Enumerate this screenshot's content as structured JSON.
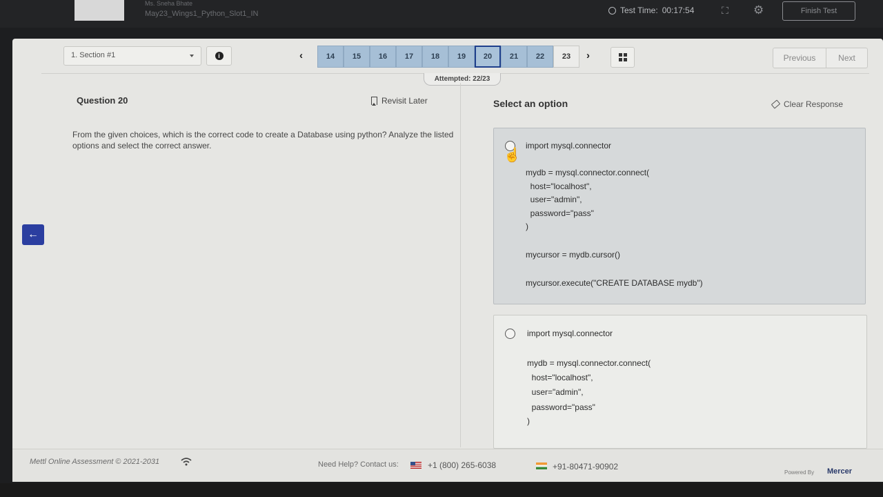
{
  "header": {
    "candidate_name": "Ms. Sneha Bhate",
    "test_name": "May23_Wings1_Python_Slot1_IN",
    "timer_label": "Test Time:",
    "timer_value": "00:17:54",
    "finish_label": "Finish Test"
  },
  "nav": {
    "section": "1. Section #1",
    "info_glyph": "i",
    "question_numbers": [
      "14",
      "15",
      "16",
      "17",
      "18",
      "19",
      "20",
      "21",
      "22",
      "23"
    ],
    "current_question": "20",
    "attempted": "Attempted: 22/23",
    "previous_label": "Previous",
    "next_label": "Next"
  },
  "question": {
    "title": "Question 20",
    "revisit_label": "Revisit Later",
    "text": "From the given choices, which is the correct code to create a Database using python? Analyze the listed options and select the correct answer."
  },
  "answer": {
    "heading": "Select an option",
    "clear_label": "Clear Response",
    "options": [
      {
        "lines": [
          "import mysql.connector",
          "",
          "mydb = mysql.connector.connect(",
          "  host=\"localhost\",",
          "  user=\"admin\",",
          "  password=\"pass\"",
          ")",
          "",
          "mycursor = mydb.cursor()",
          "",
          "mycursor.execute(\"CREATE DATABASE mydb\")"
        ]
      },
      {
        "lines": [
          "import mysql.connector",
          "",
          "mydb = mysql.connector.connect(",
          "  host=\"localhost\",",
          "  user=\"admin\",",
          "  password=\"pass\"",
          ")"
        ]
      }
    ]
  },
  "footer": {
    "copyright": "Mettl Online Assessment © 2021-2031",
    "help_label": "Need Help? Contact us:",
    "phone_us": "+1 (800) 265-6038",
    "phone_in": "+91-80471-90902",
    "powered_by": "Powered By",
    "brand": "Mercer"
  },
  "colors": {
    "accent": "#2b3ea0",
    "question_answered": "#a6bfd6",
    "current_border": "#1e3f8c"
  }
}
